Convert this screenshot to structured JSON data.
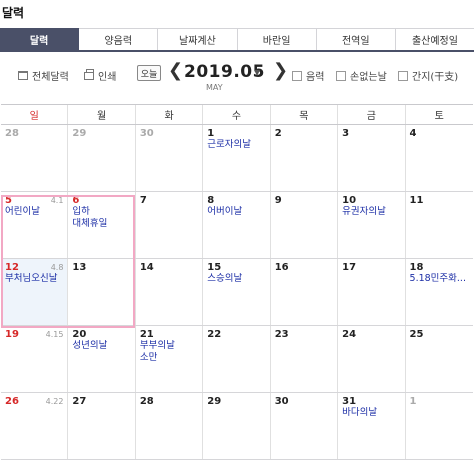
{
  "header": {
    "title": "달력"
  },
  "tabs": [
    {
      "label": "달력",
      "active": true
    },
    {
      "label": "양음력"
    },
    {
      "label": "날짜계산"
    },
    {
      "label": "바란일"
    },
    {
      "label": "전역일"
    },
    {
      "label": "출산예정일"
    }
  ],
  "toolbar": {
    "full_calendar": "전체달력",
    "print": "인쇄",
    "today": "오늘",
    "prev": "❮",
    "next": "❯",
    "month": "2019.05",
    "month_en": "MAY",
    "options": [
      "음력",
      "손없는날",
      "간지(干支)"
    ]
  },
  "weekdays": [
    "일",
    "월",
    "화",
    "수",
    "목",
    "금",
    "토"
  ],
  "weeks": [
    [
      {
        "d": "28",
        "o": true
      },
      {
        "d": "29",
        "o": true
      },
      {
        "d": "30",
        "o": true
      },
      {
        "d": "1",
        "ev": [
          "근로자의날"
        ]
      },
      {
        "d": "2"
      },
      {
        "d": "3"
      },
      {
        "d": "4"
      }
    ],
    [
      {
        "d": "5",
        "s": true,
        "l": "4.1",
        "ev": [
          "어린이날"
        ]
      },
      {
        "d": "6",
        "s": true,
        "ev": [
          "입하",
          "대체휴일"
        ]
      },
      {
        "d": "7"
      },
      {
        "d": "8",
        "ev": [
          "어버이날"
        ]
      },
      {
        "d": "9"
      },
      {
        "d": "10",
        "ev": [
          "유권자의날"
        ]
      },
      {
        "d": "11"
      }
    ],
    [
      {
        "d": "12",
        "s": true,
        "l": "4.8",
        "ev": [
          "부처님오신날"
        ],
        "hl": true
      },
      {
        "d": "13"
      },
      {
        "d": "14"
      },
      {
        "d": "15",
        "ev": [
          "스승의날"
        ]
      },
      {
        "d": "16"
      },
      {
        "d": "17"
      },
      {
        "d": "18",
        "ev": [
          "5.18민주화..."
        ]
      }
    ],
    [
      {
        "d": "19",
        "s": true,
        "l": "4.15"
      },
      {
        "d": "20",
        "ev": [
          "성년의날"
        ]
      },
      {
        "d": "21",
        "ev": [
          "부부의날",
          "소만"
        ]
      },
      {
        "d": "22"
      },
      {
        "d": "23"
      },
      {
        "d": "24"
      },
      {
        "d": "25"
      }
    ],
    [
      {
        "d": "26",
        "s": true,
        "l": "4.22"
      },
      {
        "d": "27"
      },
      {
        "d": "28"
      },
      {
        "d": "29"
      },
      {
        "d": "30"
      },
      {
        "d": "31",
        "ev": [
          "바다의날"
        ]
      },
      {
        "d": "1",
        "o": true
      }
    ]
  ]
}
